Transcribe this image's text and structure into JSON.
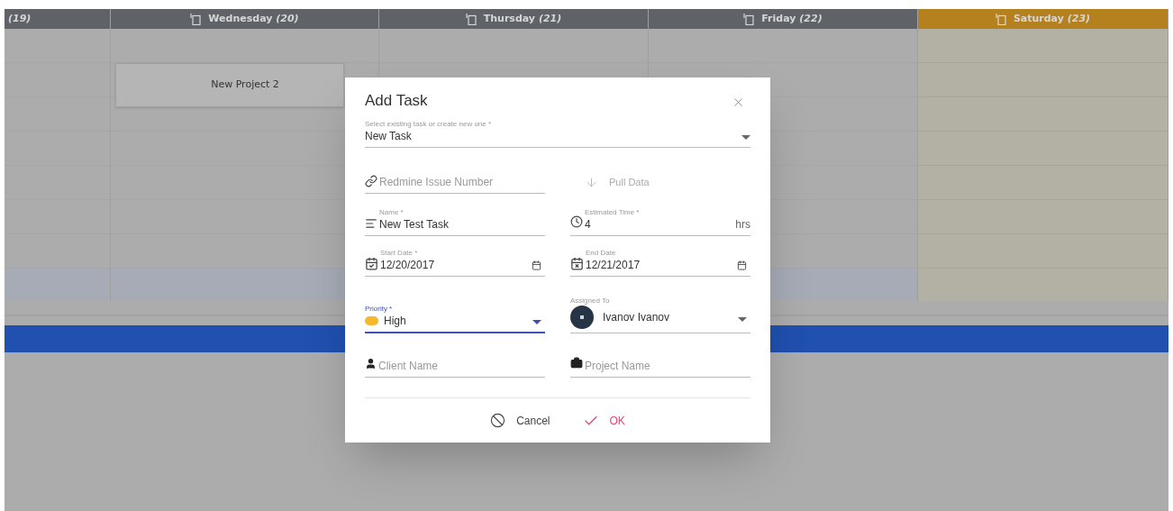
{
  "calendar": {
    "days": [
      {
        "number": "(19)",
        "highlighted": false
      },
      {
        "name": "Wednesday",
        "number": "(20)",
        "highlighted": false,
        "events": [
          {
            "title": "New Project 2"
          }
        ]
      },
      {
        "name": "Thursday",
        "number": "(21)",
        "highlighted": false
      },
      {
        "name": "Friday",
        "number": "(22)",
        "highlighted": false
      },
      {
        "name": "Saturday",
        "number": "(23)",
        "highlighted": true
      }
    ]
  },
  "dialog": {
    "title": "Add Task",
    "task_select": {
      "label": "Select existing task or create new one *",
      "value": "New Task",
      "focused": false
    },
    "redmine": {
      "placeholder": "Redmine Issue Number"
    },
    "pull_data": {
      "label": "Pull Data",
      "disabled": true
    },
    "name": {
      "label": "Name *",
      "value": "New Test Task"
    },
    "estimated_time": {
      "label": "Estimated Time *",
      "value": "4",
      "suffix": "hrs"
    },
    "start_date": {
      "label": "Start Date *",
      "value": "12/20/2017"
    },
    "end_date": {
      "label": "End Date",
      "value": "12/21/2017"
    },
    "priority": {
      "label": "Priority *",
      "value": "High",
      "color": "#f5b82e",
      "focused": true
    },
    "assigned_to": {
      "label": "Assigned To",
      "value": "Ivanov Ivanov",
      "focused": false
    },
    "client": {
      "placeholder": "Client Name"
    },
    "project": {
      "placeholder": "Project Name"
    },
    "buttons": [
      {
        "label": "Cancel",
        "kind": "cancel"
      },
      {
        "label": "OK",
        "kind": "ok"
      }
    ]
  }
}
